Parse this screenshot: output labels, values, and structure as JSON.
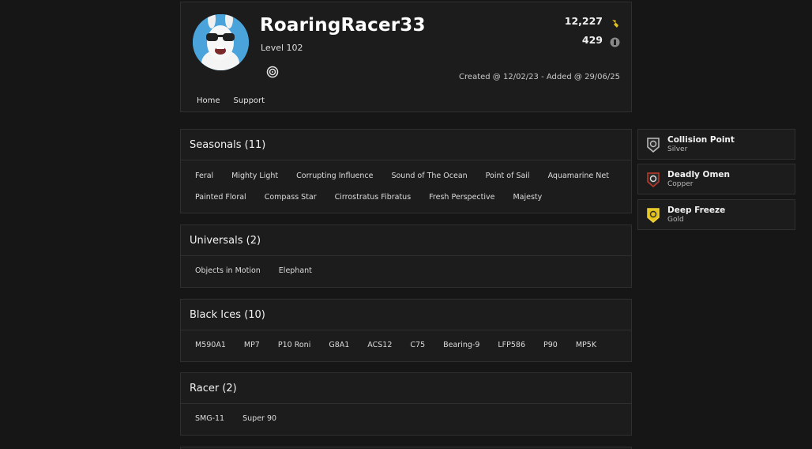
{
  "profile": {
    "username": "RoaringRacer33",
    "level": "Level 102",
    "renown": "12,227",
    "credits": "429",
    "dates": "Created @ 12/02/23 - Added @ 29/06/25",
    "nav": [
      "Home",
      "Support"
    ]
  },
  "seasonals": {
    "title": "Seasonals (11)",
    "items": [
      "Feral",
      "Mighty Light",
      "Corrupting Influence",
      "Sound of The Ocean",
      "Point of Sail",
      "Aquamarine Net",
      "Painted Floral",
      "Compass Star",
      "Cirrostratus Fibratus",
      "Fresh Perspective",
      "Majesty"
    ]
  },
  "universals": {
    "title": "Universals (2)",
    "items": [
      "Objects in Motion",
      "Elephant"
    ]
  },
  "black_ices": {
    "title": "Black Ices (10)",
    "items": [
      "M590A1",
      "MP7",
      "P10 Roni",
      "G8A1",
      "ACS12",
      "C75",
      "Bearing-9",
      "LFP586",
      "P90",
      "MP5K"
    ]
  },
  "racer": {
    "title": "Racer (2)",
    "items": [
      "SMG-11",
      "Super 90"
    ]
  },
  "badges": [
    {
      "name": "Collision Point",
      "tier": "Silver",
      "color": "#c0c0c0"
    },
    {
      "name": "Deadly Omen",
      "tier": "Copper",
      "color": "#c0392b"
    },
    {
      "name": "Deep Freeze",
      "tier": "Gold",
      "color": "#e3c21c"
    }
  ],
  "icons": {
    "renown": "renown-icon",
    "credits": "r6-credits-icon",
    "ubisoft": "ubisoft-icon"
  }
}
